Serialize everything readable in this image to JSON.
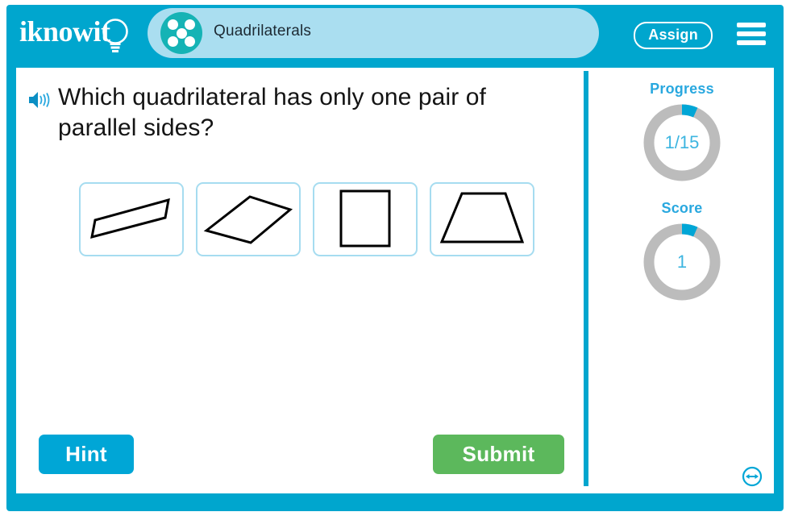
{
  "header": {
    "logo_text": "iknowit",
    "logo_icon": "lightbulb-icon",
    "title": "Quadrilaterals",
    "title_icon": "dice-five-icon",
    "assign_label": "Assign",
    "menu_icon": "hamburger-menu-icon",
    "bg_color": "#00a6ce",
    "title_panel_color": "#aadef0",
    "dice_color": "#15b3b5"
  },
  "question": {
    "audio_icon": "speaker-icon",
    "text": "Which quadrilateral has only one pair of parallel sides?"
  },
  "options": [
    {
      "name": "rotated-rectangle",
      "shape": "rectangle"
    },
    {
      "name": "rhombus",
      "shape": "rhombus"
    },
    {
      "name": "square",
      "shape": "square"
    },
    {
      "name": "trapezoid",
      "shape": "trapezoid"
    }
  ],
  "footer": {
    "hint_label": "Hint",
    "hint_color": "#00a6d6",
    "submit_label": "Submit",
    "submit_color": "#5cb85c",
    "resize_icon": "resize-horizontal-icon"
  },
  "sidebar": {
    "progress": {
      "label": "Progress",
      "value": "1/15",
      "current": 1,
      "total": 15,
      "percent": 6.7,
      "arc_color": "#00a6d6",
      "track_color": "#bcbcbc"
    },
    "score": {
      "label": "Score",
      "value": "1",
      "percent": 6.7,
      "arc_color": "#00a6d6",
      "track_color": "#bcbcbc"
    }
  }
}
